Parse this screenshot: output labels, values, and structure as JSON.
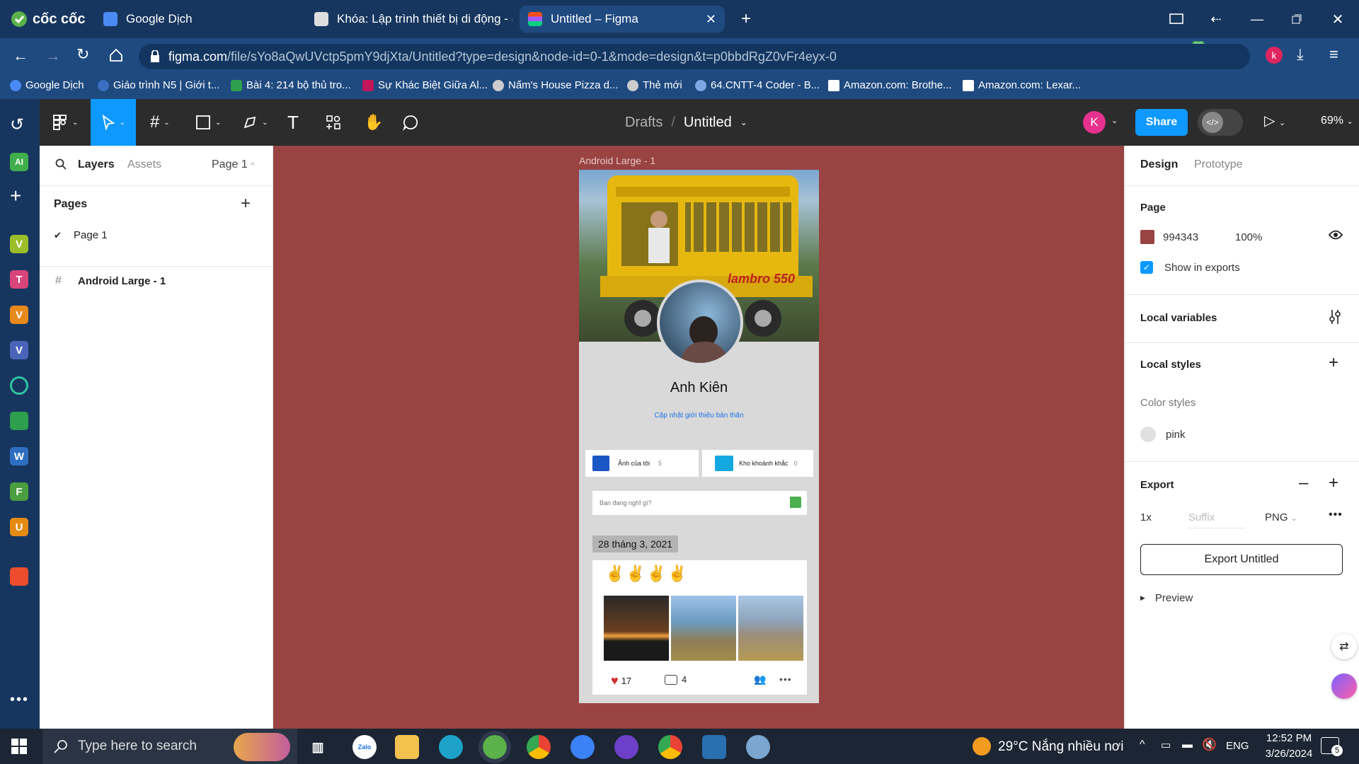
{
  "browser": {
    "name": "cốc cốc",
    "tabs": [
      {
        "title": "Google Dịch"
      },
      {
        "title": "Khóa: Lập trình thiết bị di động - (",
        "active": false
      },
      {
        "title": "Untitled – Figma",
        "active": true
      }
    ],
    "url_host": "figma.com",
    "url_path": "/file/sYo8aQwUVctp5pmY9djXta/Untitled?type=design&node-id=0-1&mode=design&t=p0bbdRgZ0vFr4eyx-0",
    "extension_badge": "93",
    "profile_initial": "k",
    "bookmarks": [
      "Google Dịch",
      "Giáo trình N5 | Giới t...",
      "Bài 4: 214 bộ thủ tro...",
      "Sự Khác Biệt Giữa Al...",
      "Nấm's House Pizza d...",
      "Thẻ mới",
      "64.CNTT-4 Coder - B...",
      "Amazon.com: Brothe...",
      "Amazon.com: Lexar..."
    ]
  },
  "sidebar_apps": [
    "AI",
    "V",
    "T",
    "V",
    "V",
    "W",
    "F",
    "U"
  ],
  "figma": {
    "breadcrumb_root": "Drafts",
    "file_name": "Untitled",
    "user_initial": "K",
    "share_label": "Share",
    "zoom": "69%",
    "left_tabs": {
      "layers": "Layers",
      "assets": "Assets",
      "page_selector": "Page 1"
    },
    "pages_title": "Pages",
    "pages": [
      "Page 1"
    ],
    "layers": [
      "Android Large - 1"
    ],
    "right_tabs": {
      "design": "Design",
      "prototype": "Prototype"
    },
    "page_section": {
      "title": "Page",
      "color_hex": "994343",
      "opacity": "100%",
      "show_in_exports": "Show in exports"
    },
    "local_variables": "Local variables",
    "local_styles": "Local styles",
    "color_styles_title": "Color styles",
    "color_styles": [
      "pink"
    ],
    "export": {
      "title": "Export",
      "scale": "1x",
      "suffix_placeholder": "Suffix",
      "format": "PNG",
      "button": "Export Untitled",
      "preview": "Preview"
    }
  },
  "frame": {
    "label": "Android Large - 1",
    "profile_name": "Anh Kiên",
    "profile_link": "Cập nhật giới thiệu bản thân",
    "albums": [
      {
        "label": "Ảnh của tôi",
        "count": "5"
      },
      {
        "label": "Kho khoảnh khắc",
        "count": "0"
      }
    ],
    "status_placeholder": "Bạn đang nghĩ gì?",
    "date": "28 tháng 3, 2021",
    "post_emojis": "✌✌✌✌",
    "likes": "17",
    "comments": "4"
  },
  "taskbar": {
    "search_placeholder": "Type here to search",
    "weather": "29°C  Nắng nhiều nơi",
    "lang": "ENG",
    "time": "12:52 PM",
    "date": "3/26/2024",
    "notifications": "5"
  },
  "colors": {
    "page_bg": "#994343",
    "share_blue": "#0d99ff",
    "toolbar": "#2c2c2c",
    "browser": "#17365f"
  }
}
